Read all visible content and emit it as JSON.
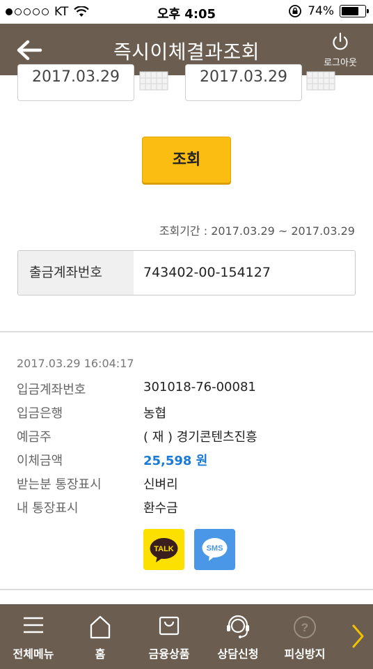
{
  "status_bar": {
    "carrier": "KT",
    "time": "오후 4:05",
    "battery_text": "74%",
    "battery_level": 0.74,
    "signal_bars_filled": 1,
    "signal_bars_total": 5
  },
  "header": {
    "title": "즉시이체결과조회",
    "back_icon": "arrow-left-icon",
    "logout_label": "로그아웃",
    "logout_icon": "power-icon"
  },
  "search": {
    "start_date": "2017.03.29",
    "end_date": "2017.03.29",
    "calendar_icon": "calendar-icon",
    "button_label": "조회",
    "period_text": "조회기간 : 2017.03.29 ~ 2017.03.29"
  },
  "account": {
    "label": "출금계좌번호",
    "value": "743402-00-154127"
  },
  "result": {
    "datetime": "2017.03.29 16:04:17",
    "rows": [
      {
        "label": "입금계좌번호",
        "value": "301018-76-00081"
      },
      {
        "label": "입금은행",
        "value": "농협"
      },
      {
        "label": "예금주",
        "value": "( 재 ) 경기콘텐츠진흥"
      },
      {
        "label": "이체금액",
        "value": "25,598 원"
      },
      {
        "label": "받는분 통장표시",
        "value": "신벼리"
      },
      {
        "label": "내 통장표시",
        "value": "환수금"
      }
    ],
    "share": {
      "talk_label": "TALK",
      "sms_label": "SMS"
    }
  },
  "tabbar": {
    "items": [
      {
        "label": "전체메뉴",
        "icon": "menu-icon"
      },
      {
        "label": "홈",
        "icon": "home-icon"
      },
      {
        "label": "금융상품",
        "icon": "shopping-bag-icon"
      },
      {
        "label": "상담신청",
        "icon": "headset-icon"
      },
      {
        "label": "피싱방지",
        "icon": "question-circle-icon"
      }
    ],
    "more_icon": "chevron-right-icon"
  },
  "colors": {
    "header_bg": "#6b5e50",
    "button_yellow": "#fbbd11",
    "amount_blue": "#1a7bd6",
    "kakao_yellow": "#fce100",
    "sms_blue": "#4a97e8",
    "chevron_yellow": "#f2c200"
  }
}
